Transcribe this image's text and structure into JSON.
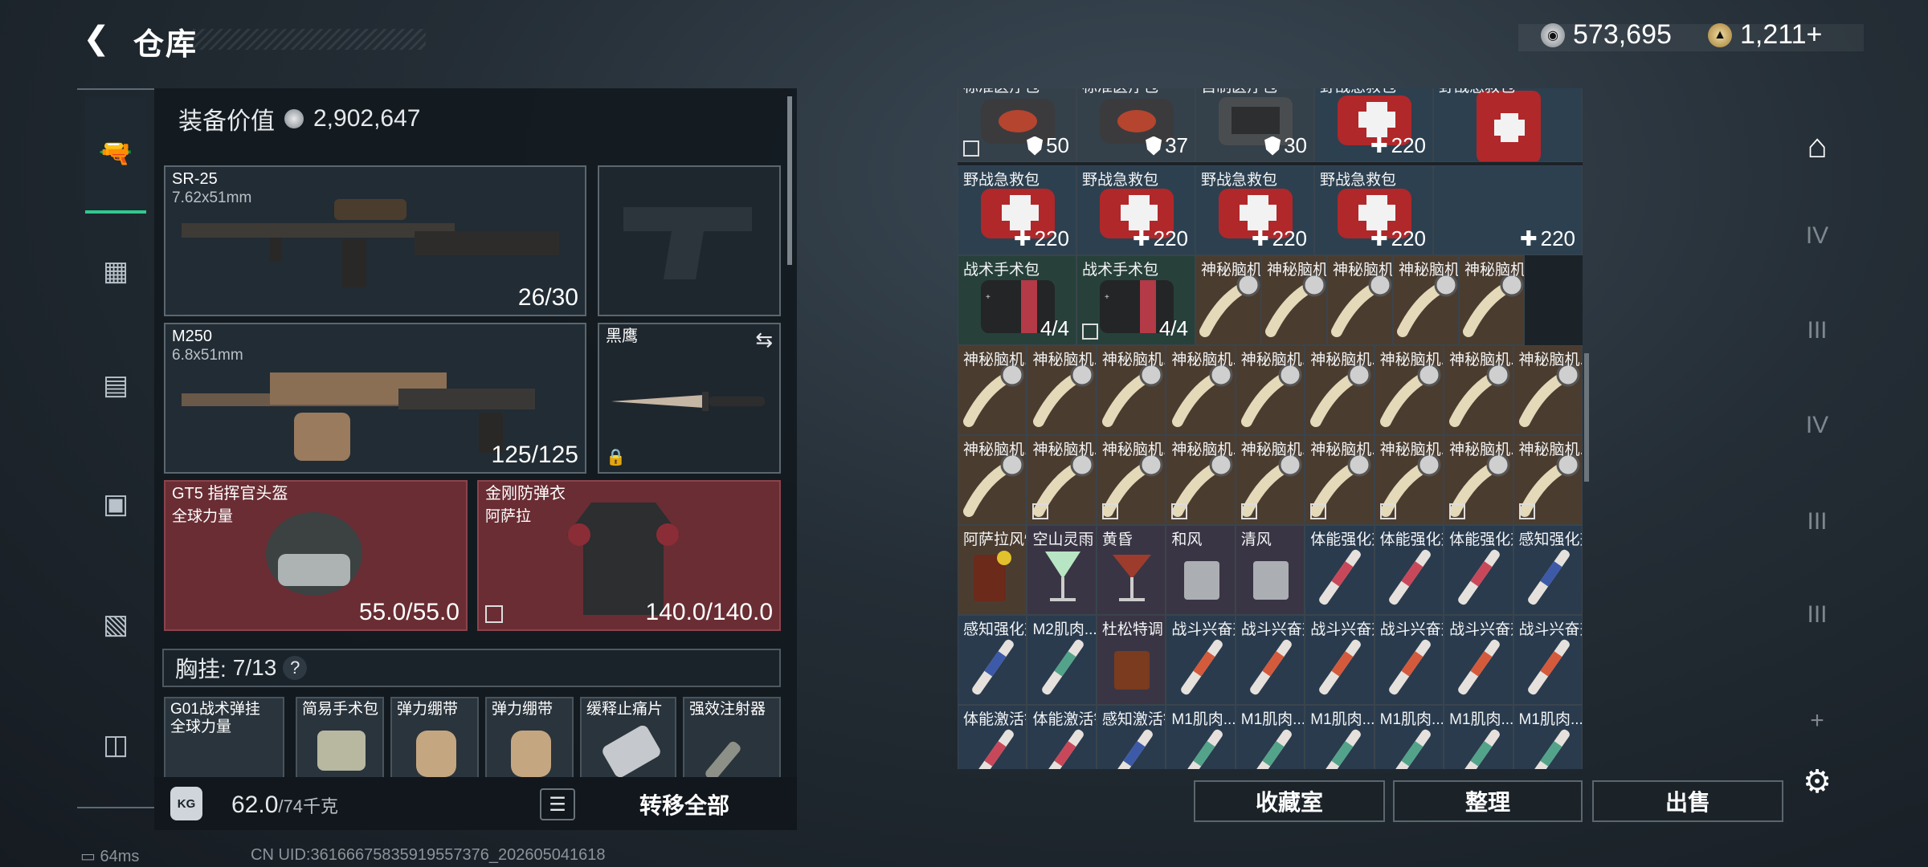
{
  "header": {
    "title": "仓库",
    "silver": "573,695",
    "gold": "1,211+"
  },
  "equipment": {
    "value_label": "装备价值",
    "value": "2,902,647",
    "primary": {
      "name": "SR-25",
      "caliber": "7.62x51mm",
      "ammo": "26/30"
    },
    "secondary": {
      "name": "M250",
      "caliber": "6.8x51mm",
      "ammo": "125/125"
    },
    "melee": {
      "name": "黑鹰"
    },
    "helmet": {
      "name": "GT5 指挥官头盔",
      "sub": "全球力量",
      "durability": "55.0/55.0"
    },
    "armor": {
      "name": "金刚防弹衣",
      "sub": "阿萨拉",
      "durability": "140.0/140.0"
    },
    "chest": {
      "label": "胸挂:",
      "count": "7/13",
      "help": "?"
    },
    "chest_items": [
      {
        "name": "G01战术弹挂",
        "sub": "全球力量"
      },
      {
        "name": "简易手术包"
      },
      {
        "name": "弹力绷带"
      },
      {
        "name": "弹力绷带"
      },
      {
        "name": "缓释止痛片"
      },
      {
        "name": "强效注射器"
      }
    ],
    "weight": "62.0",
    "weight_max": "/74千克",
    "transfer": "转移全部"
  },
  "status": {
    "ping": "64ms",
    "uid": "CN UID:36166675835919557376_202605041618"
  },
  "grid": {
    "rows": [
      [
        {
          "label": "标准医疗包",
          "count": "50",
          "icon": "shield",
          "kind": "bag",
          "cls": "c-grey",
          "lock": true
        },
        {
          "label": "标准医疗包",
          "count": "37",
          "icon": "shield",
          "kind": "bag",
          "cls": "c-grey"
        },
        {
          "label": "自制医疗包",
          "count": "30",
          "icon": "shield",
          "kind": "bag2",
          "cls": "c-grey"
        },
        {
          "label": "野战急救包",
          "count": "220",
          "icon": "plus",
          "kind": "aid",
          "cls": "c-med"
        },
        {
          "label": "野战急救包",
          "count": "",
          "icon": "",
          "kind": "aidv",
          "cls": "c-med"
        }
      ],
      [
        {
          "label": "野战急救包",
          "count": "220",
          "icon": "plus",
          "kind": "aid",
          "cls": "c-med"
        },
        {
          "label": "野战急救包",
          "count": "220",
          "icon": "plus",
          "kind": "aid",
          "cls": "c-med"
        },
        {
          "label": "野战急救包",
          "count": "220",
          "icon": "plus",
          "kind": "aid",
          "cls": "c-med"
        },
        {
          "label": "野战急救包",
          "count": "220",
          "icon": "plus",
          "kind": "aid",
          "cls": "c-med"
        },
        {
          "label": "",
          "count": "220",
          "icon": "plus",
          "kind": "none",
          "cls": "c-med"
        }
      ],
      [
        {
          "label": "战术手术包",
          "count": "4/4",
          "icon": "",
          "kind": "kit",
          "cls": "c-green"
        },
        {
          "label": "战术手术包",
          "count": "4/4",
          "icon": "",
          "kind": "kit",
          "cls": "c-green",
          "lock": true
        },
        {
          "label": "神秘脑机...",
          "kind": "brain",
          "cls": "c-brown"
        },
        {
          "label": "神秘脑机...",
          "kind": "brain",
          "cls": "c-brown"
        },
        {
          "label": "神秘脑机...",
          "kind": "brain",
          "cls": "c-brown"
        },
        {
          "label": "神秘脑机...",
          "kind": "brain",
          "cls": "c-brown"
        },
        {
          "label": "神秘脑机...",
          "kind": "brain",
          "cls": "c-brown"
        }
      ],
      [
        {
          "label": "神秘脑机...",
          "kind": "brain",
          "cls": "c-brown"
        },
        {
          "label": "神秘脑机...",
          "kind": "brain",
          "cls": "c-brown"
        },
        {
          "label": "神秘脑机...",
          "kind": "brain",
          "cls": "c-brown"
        },
        {
          "label": "神秘脑机...",
          "kind": "brain",
          "cls": "c-brown"
        },
        {
          "label": "神秘脑机...",
          "kind": "brain",
          "cls": "c-brown"
        },
        {
          "label": "神秘脑机...",
          "kind": "brain",
          "cls": "c-brown"
        },
        {
          "label": "神秘脑机...",
          "kind": "brain",
          "cls": "c-brown"
        },
        {
          "label": "神秘脑机...",
          "kind": "brain",
          "cls": "c-brown"
        },
        {
          "label": "神秘脑机...",
          "kind": "brain",
          "cls": "c-brown"
        }
      ],
      [
        {
          "label": "神秘脑机...",
          "kind": "brain",
          "cls": "c-brown"
        },
        {
          "label": "神秘脑机...",
          "kind": "brain",
          "cls": "c-brown",
          "lock": true
        },
        {
          "label": "神秘脑机...",
          "kind": "brain",
          "cls": "c-brown",
          "lock": true
        },
        {
          "label": "神秘脑机...",
          "kind": "brain",
          "cls": "c-brown",
          "lock": true
        },
        {
          "label": "神秘脑机...",
          "kind": "brain",
          "cls": "c-brown",
          "lock": true
        },
        {
          "label": "神秘脑机...",
          "kind": "brain",
          "cls": "c-brown",
          "lock": true
        },
        {
          "label": "神秘脑机...",
          "kind": "brain",
          "cls": "c-brown",
          "lock": true
        },
        {
          "label": "神秘脑机...",
          "kind": "brain",
          "cls": "c-brown",
          "lock": true
        },
        {
          "label": "神秘脑机...",
          "kind": "brain",
          "cls": "c-brown",
          "lock": true
        }
      ],
      [
        {
          "label": "阿萨拉风情",
          "kind": "drink",
          "cls": "c-brown"
        },
        {
          "label": "空山灵雨",
          "kind": "drink2",
          "cls": "c-drink"
        },
        {
          "label": "黄昏",
          "kind": "drink3",
          "cls": "c-drink"
        },
        {
          "label": "和风",
          "kind": "glass",
          "cls": "c-drink"
        },
        {
          "label": "清风",
          "kind": "glass",
          "cls": "c-drink"
        },
        {
          "label": "体能强化剂",
          "kind": "syr-r",
          "cls": "c-blue"
        },
        {
          "label": "体能强化剂",
          "kind": "syr-r",
          "cls": "c-blue"
        },
        {
          "label": "体能强化剂",
          "kind": "syr-r",
          "cls": "c-blue"
        },
        {
          "label": "感知强化剂",
          "kind": "syr-b",
          "cls": "c-blue"
        }
      ],
      [
        {
          "label": "感知强化剂",
          "kind": "syr-b",
          "cls": "c-blue"
        },
        {
          "label": "M2肌肉...",
          "kind": "syr-g",
          "cls": "c-blue"
        },
        {
          "label": "杜松特调",
          "kind": "glass2",
          "cls": "c-drink"
        },
        {
          "label": "战斗兴奋剂",
          "kind": "syr-o",
          "cls": "c-blue"
        },
        {
          "label": "战斗兴奋剂",
          "kind": "syr-o",
          "cls": "c-blue"
        },
        {
          "label": "战斗兴奋剂",
          "kind": "syr-o",
          "cls": "c-blue"
        },
        {
          "label": "战斗兴奋剂",
          "kind": "syr-o",
          "cls": "c-blue"
        },
        {
          "label": "战斗兴奋剂",
          "kind": "syr-o",
          "cls": "c-blue"
        },
        {
          "label": "战斗兴奋剂",
          "kind": "syr-o",
          "cls": "c-blue"
        }
      ],
      [
        {
          "label": "体能激活针",
          "kind": "syr-r",
          "cls": "c-blue"
        },
        {
          "label": "体能激活针",
          "kind": "syr-r",
          "cls": "c-blue"
        },
        {
          "label": "感知激活针",
          "kind": "syr-b",
          "cls": "c-blue"
        },
        {
          "label": "M1肌肉...",
          "kind": "syr-g",
          "cls": "c-blue"
        },
        {
          "label": "M1肌肉...",
          "kind": "syr-g",
          "cls": "c-blue"
        },
        {
          "label": "M1肌肉...",
          "kind": "syr-g",
          "cls": "c-blue"
        },
        {
          "label": "M1肌肉...",
          "kind": "syr-g",
          "cls": "c-blue"
        },
        {
          "label": "M1肌肉...",
          "kind": "syr-g",
          "cls": "c-blue"
        },
        {
          "label": "M1肌肉...",
          "kind": "syr-g",
          "cls": "c-blue"
        }
      ]
    ]
  },
  "buttons": {
    "collection": "收藏室",
    "sort": "整理",
    "sell": "出售"
  },
  "right_rail": {
    "items": [
      "warehouse-icon",
      "tier-iv-crafting-icon",
      "tier-iii-workbench-icon",
      "tier-iv-storage-icon",
      "tier-iii-hazard-icon",
      "tier-iii-gun-icon",
      "add-icon",
      "settings-icon"
    ],
    "labels": [
      "",
      "IV",
      "III",
      "IV",
      "III",
      "III",
      "+",
      ""
    ]
  },
  "left_nav": {
    "items": [
      "gun-icon",
      "vest-icon",
      "backpack-icon",
      "pouch-icon",
      "container-icon",
      "case-icon"
    ]
  }
}
